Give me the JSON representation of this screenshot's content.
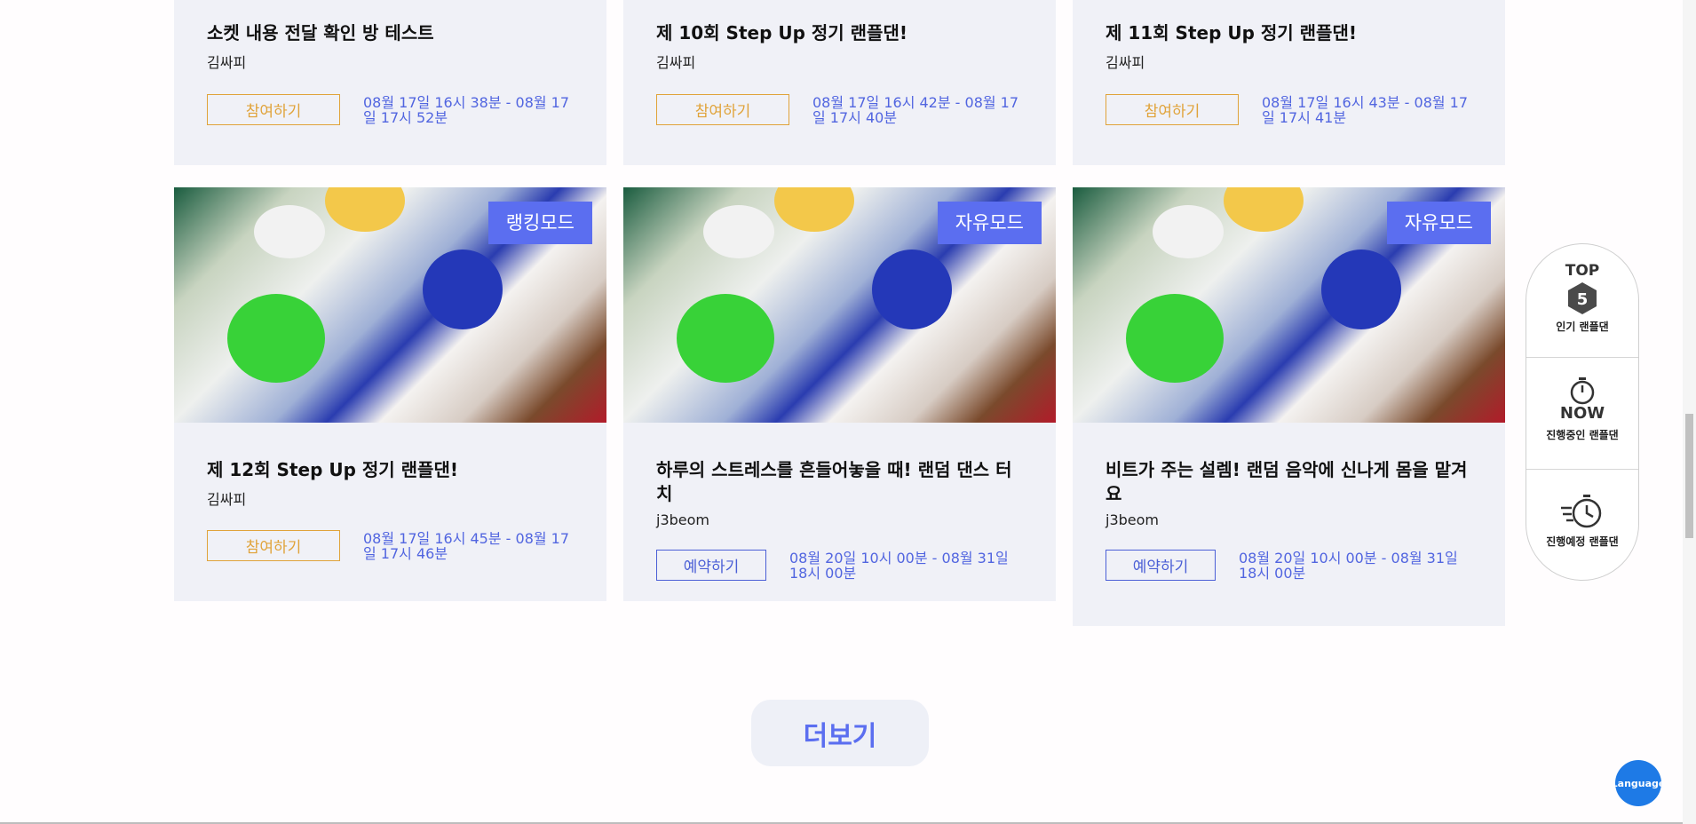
{
  "cards": [
    {
      "title": "소켓 내용 전달 확인 방 테스트",
      "author": "김싸피",
      "action": "참여하기",
      "period": "08월 17일 16시 38분 - 08월 17일 17시 52분"
    },
    {
      "title": "제 10회 Step Up 정기 랜플댄!",
      "author": "김싸피",
      "action": "참여하기",
      "period": "08월 17일 16시 42분 - 08월 17일 17시 40분"
    },
    {
      "title": "제 11회 Step Up 정기 랜플댄!",
      "author": "김싸피",
      "action": "참여하기",
      "period": "08월 17일 16시 43분 - 08월 17일 17시 41분"
    },
    {
      "mode": "랭킹모드",
      "title": "제 12회 Step Up 정기 랜플댄!",
      "author": "김싸피",
      "action": "참여하기",
      "period": "08월 17일 16시 45분 - 08월 17일 17시 46분"
    },
    {
      "mode": "자유모드",
      "title": "하루의 스트레스를 흔들어놓을 때! 랜덤 댄스 터치",
      "author": "j3beom",
      "action": "예약하기",
      "period": "08월 20일 10시 00분 - 08월 31일 18시 00분"
    },
    {
      "mode": "자유모드",
      "title": "비트가 주는 설렘! 랜덤 음악에 신나게 몸을 맡겨요",
      "author": "j3beom",
      "action": "예약하기",
      "period": "08월 20일 10시 00분 - 08월 31일 18시 00분"
    }
  ],
  "more_button": "더보기",
  "side_panel": {
    "top_label": "TOP",
    "top_number": "5",
    "top_caption": "인기 랜플댄",
    "now_label": "NOW",
    "now_caption": "진행중인 랜플댄",
    "upcoming_caption": "진행예정 랜플댄"
  },
  "language_button": "Language",
  "colors": {
    "accent": "#5b6ef0",
    "join": "#e0a33a",
    "reserve": "#4b5fd6",
    "card_bg": "#f0f1f7"
  }
}
